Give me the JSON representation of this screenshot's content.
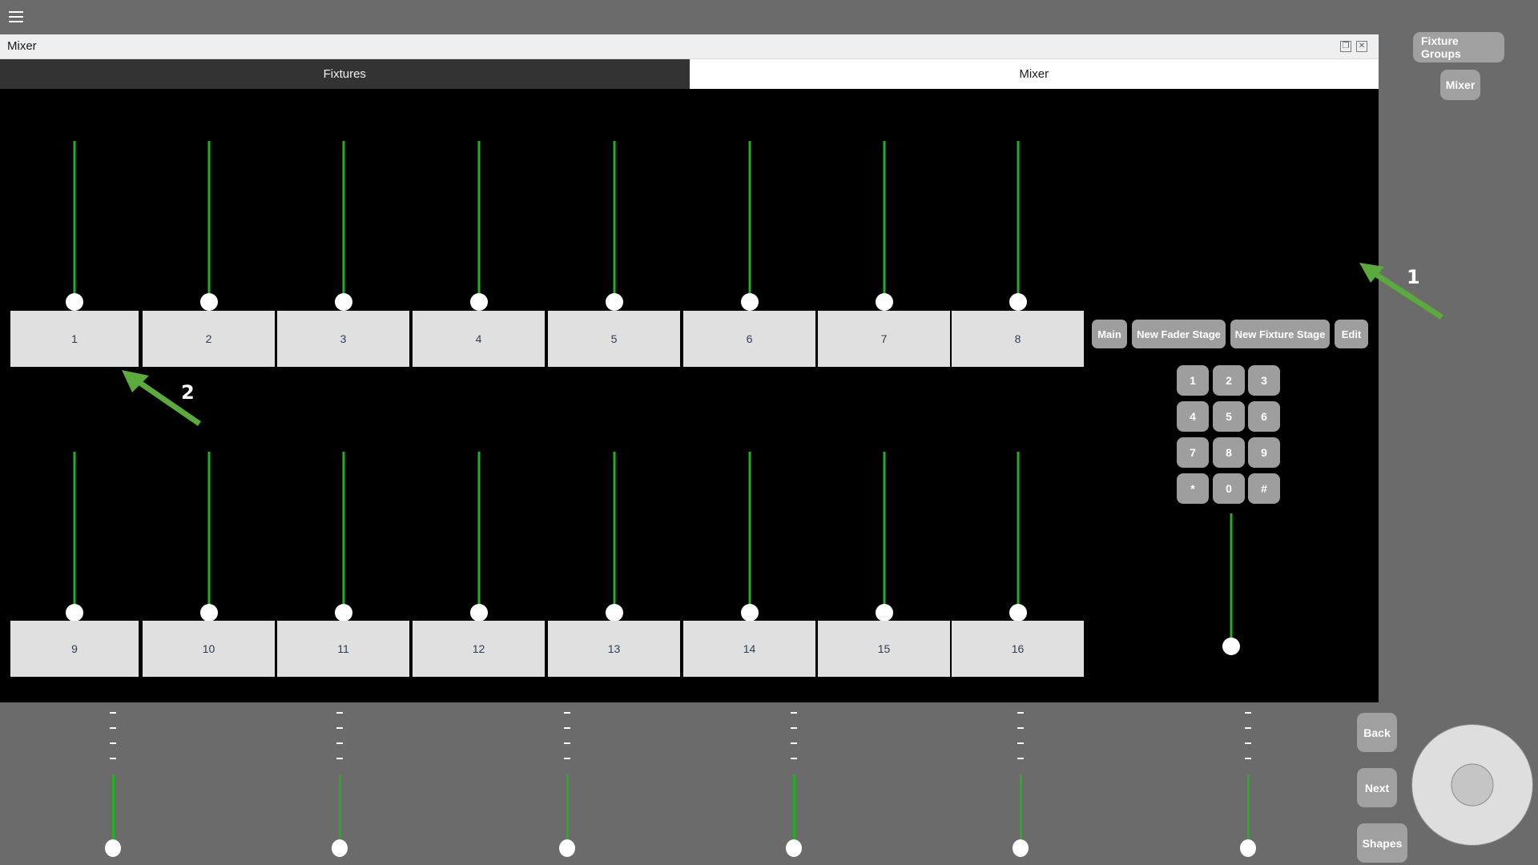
{
  "app": {
    "menu_icon": "hamburger-menu-icon",
    "background_color": "#6b6b6b"
  },
  "window": {
    "title": "Mixer",
    "restore_icon": "❐",
    "close_icon": "✕",
    "tabs": [
      {
        "label": "Fixtures",
        "active": false
      },
      {
        "label": "Mixer",
        "active": true
      }
    ]
  },
  "stage": {
    "background_color": "#000000",
    "fader_color": "#22b022",
    "knob_color": "#ffffff",
    "fixture_button_color": "#e0e0e0",
    "row1_buttons": [
      "1",
      "2",
      "3",
      "4",
      "5",
      "6",
      "7",
      "8"
    ],
    "row2_buttons": [
      "9",
      "10",
      "11",
      "12",
      "13",
      "14",
      "15",
      "16"
    ],
    "stage_buttons": [
      "Main",
      "New Fader Stage",
      "New Fixture Stage",
      "Edit"
    ],
    "keypad": [
      "1",
      "2",
      "3",
      "4",
      "5",
      "6",
      "7",
      "8",
      "9",
      "*",
      "0",
      "#"
    ]
  },
  "sidebar": {
    "buttons": [
      "Fixture Groups",
      "Mixer"
    ]
  },
  "bottom": {
    "buttons": [
      "Back",
      "Next",
      "Shapes"
    ],
    "fader_count": 6,
    "dash_mark": "-",
    "dashes_per_fader": 4,
    "jog_wheel_name": "jog-wheel"
  },
  "annotations": [
    {
      "label": "1",
      "target": "Edit"
    },
    {
      "label": "2",
      "target": "fixture-button-1"
    }
  ]
}
